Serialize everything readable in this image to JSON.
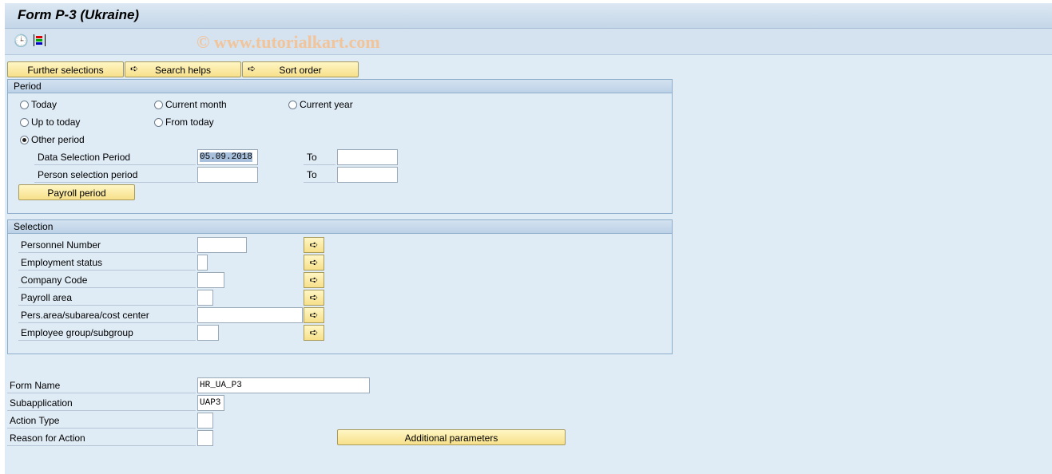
{
  "title": "Form P-3 (Ukraine)",
  "watermark": "© www.tutorialkart.com",
  "toolbar": {
    "icons": [
      "execute-clock-icon",
      "selection-options-icon"
    ]
  },
  "tabs": {
    "further": "Further selections",
    "search": "Search helps",
    "sort": "Sort order"
  },
  "period": {
    "header": "Period",
    "today": "Today",
    "current_month": "Current month",
    "current_year": "Current year",
    "up_to_today": "Up to today",
    "from_today": "From today",
    "other_period": "Other period",
    "selected": "Other period",
    "data_sel_label": "Data Selection Period",
    "data_sel_from": "05.09.2018",
    "data_sel_to": "",
    "person_sel_label": "Person selection period",
    "person_sel_from": "",
    "person_sel_to": "",
    "to": "To",
    "payroll_button": "Payroll period"
  },
  "selection": {
    "header": "Selection",
    "fields": [
      {
        "label": "Personnel Number",
        "value": ""
      },
      {
        "label": "Employment status",
        "value": ""
      },
      {
        "label": "Company Code",
        "value": ""
      },
      {
        "label": "Payroll area",
        "value": ""
      },
      {
        "label": "Pers.area/subarea/cost center",
        "value": ""
      },
      {
        "label": "Employee group/subgroup",
        "value": ""
      }
    ]
  },
  "form": {
    "form_name_label": "Form Name",
    "form_name": "HR_UA_P3",
    "subapp_label": "Subapplication",
    "subapp": "UAP3",
    "action_type_label": "Action Type",
    "action_type": "",
    "reason_label": "Reason for Action",
    "reason": "",
    "additional_button": "Additional parameters"
  }
}
